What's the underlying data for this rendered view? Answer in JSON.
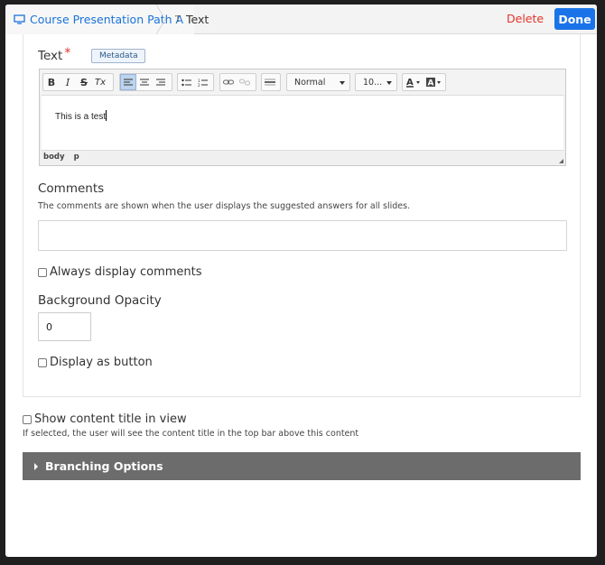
{
  "topbar": {
    "breadcrumb_first": "Course Presentation Path A",
    "breadcrumb_second": "Text",
    "type_glyph": "T",
    "delete_label": "Delete",
    "done_label": "Done"
  },
  "text_field": {
    "label": "Text",
    "required_mark": "*",
    "metadata_label": "Metadata",
    "toolbar": {
      "bold": "B",
      "italic": "I",
      "strike": "S",
      "clear_format": "Tx",
      "format_value": "Normal",
      "size_value": "10..."
    },
    "content": "This is a test",
    "path": [
      "body",
      "p"
    ]
  },
  "comments": {
    "label": "Comments",
    "help": "The comments are shown when the user displays the suggested answers for all slides.",
    "value": ""
  },
  "always_display": {
    "label": "Always display comments",
    "checked": false
  },
  "opacity": {
    "label": "Background Opacity",
    "value": "0"
  },
  "display_button": {
    "label": "Display as button",
    "checked": false
  },
  "show_title": {
    "label": "Show content title in view",
    "checked": false,
    "help": "If selected, the user will see the content title in the top bar above this content"
  },
  "branching": {
    "label": "Branching Options"
  },
  "colors": {
    "accent": "#1a73e8",
    "delete": "#e4332a",
    "branch_bar": "#6c6c6c"
  }
}
